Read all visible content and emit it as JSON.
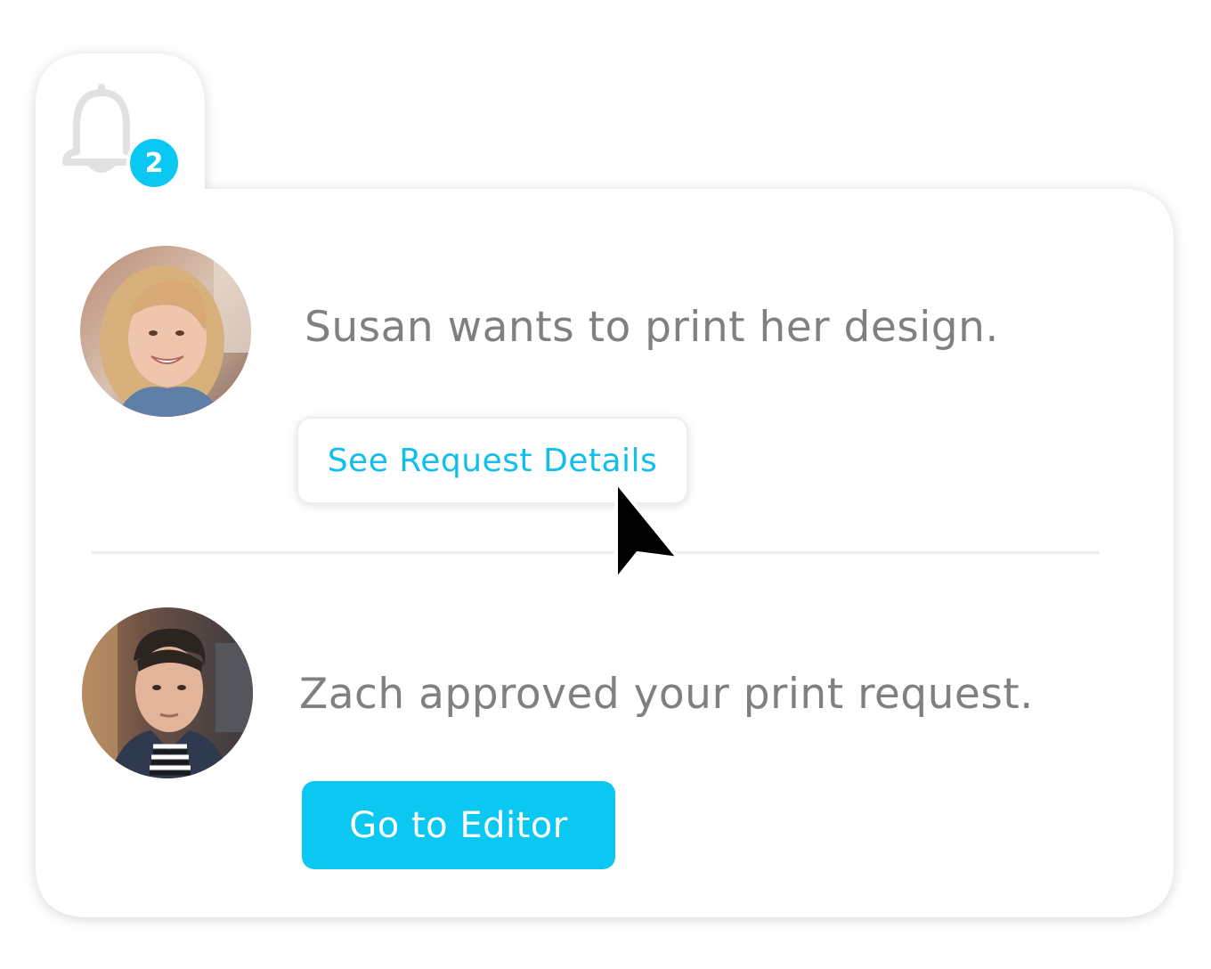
{
  "colors": {
    "accent": "#0BC8F2",
    "message_text": "#808080",
    "link_text": "#12BEEB",
    "panel_bg": "#ffffff"
  },
  "notifications": {
    "bell_icon": "bell-icon",
    "unread_count": "2",
    "items": [
      {
        "avatar": "avatar-photo-woman",
        "message": "Susan wants to print her design.",
        "action_label": "See Request Details",
        "action_style": "outline"
      },
      {
        "avatar": "avatar-photo-man",
        "message": "Zach approved your print request.",
        "action_label": "Go to Editor",
        "action_style": "filled"
      }
    ]
  }
}
